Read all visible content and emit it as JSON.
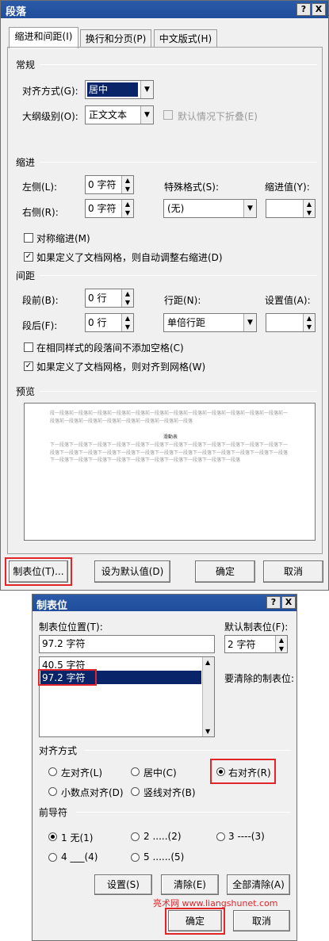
{
  "dialog1": {
    "title": "段落",
    "help_btn": "?",
    "close_btn": "X",
    "tabs": [
      "缩进和间距(I)",
      "换行和分页(P)",
      "中文版式(H)"
    ],
    "general": {
      "section": "常规",
      "align_label": "对齐方式(G):",
      "align_value": "居中",
      "outline_label": "大纲级别(O):",
      "outline_value": "正文文本",
      "collapse_label": "默认情况下折叠(E)"
    },
    "indent": {
      "section": "缩进",
      "left_label": "左侧(L):",
      "left_value": "0 字符",
      "right_label": "右侧(R):",
      "right_value": "0 字符",
      "special_label": "特殊格式(S):",
      "special_value": "(无)",
      "by_label": "缩进值(Y):",
      "by_value": "",
      "mirror_label": "对称缩进(M)",
      "auto_adjust_label": "如果定义了文档网格，则自动调整右缩进(D)"
    },
    "spacing": {
      "section": "间距",
      "before_label": "段前(B):",
      "before_value": "0 行",
      "after_label": "段后(F):",
      "after_value": "0 行",
      "line_label": "行距(N):",
      "line_value": "单倍行距",
      "at_label": "设置值(A):",
      "at_value": "",
      "no_space_label": "在相同样式的段落间不添加空格(C)",
      "snap_grid_label": "如果定义了文档网格，则对齐到网格(W)"
    },
    "preview": {
      "section": "预览",
      "prev_para": "段一段落前一段落前一段落前一段落前一段落前一段落前一段落前一段落前一段落前一段落前一段落前一段落前一段落前一段落前一段落前一段落前一段落前一段落前一段落前一段落",
      "sample": "滑動表",
      "next_para": "下一段落下一段落下一段落下一段落下一段落下一段落下一段落下一段落下一段落下一段落下一段落下一段落下一段落下一段落下一段落下一段落下一段落下一段落下一段落下一段落下一段落下一段落下一段落下一段落下一段落下一段落下一段落下一段落下一段落下一段落下一段落下一段落下一段落下一段落下一段落"
    },
    "buttons": {
      "tabs": "制表位(T)...",
      "default": "设为默认值(D)",
      "ok": "确定",
      "cancel": "取消"
    }
  },
  "dialog2": {
    "title": "制表位",
    "help_btn": "?",
    "close_btn": "X",
    "position_label": "制表位位置(T):",
    "position_value": "97.2 字符",
    "default_label": "默认制表位(F):",
    "default_value": "2 字符",
    "list_items": [
      "40.5 字符",
      "97.2 字符"
    ],
    "clear_label": "要清除的制表位:",
    "alignment": {
      "section": "对齐方式",
      "left": "左对齐(L)",
      "center": "居中(C)",
      "right": "右对齐(R)",
      "decimal": "小数点对齐(D)",
      "bar": "竖线对齐(B)"
    },
    "leader": {
      "section": "前导符",
      "l1": "1 无(1)",
      "l2": "2 .....(2)",
      "l3": "3 ----(3)",
      "l4": "4 ___(4)",
      "l5": "5 ......(5)"
    },
    "buttons": {
      "set": "设置(S)",
      "clear": "清除(E)",
      "clear_all": "全部清除(A)",
      "ok": "确定",
      "cancel": "取消"
    },
    "watermark": "亮术网 www.liangshunet.com"
  }
}
